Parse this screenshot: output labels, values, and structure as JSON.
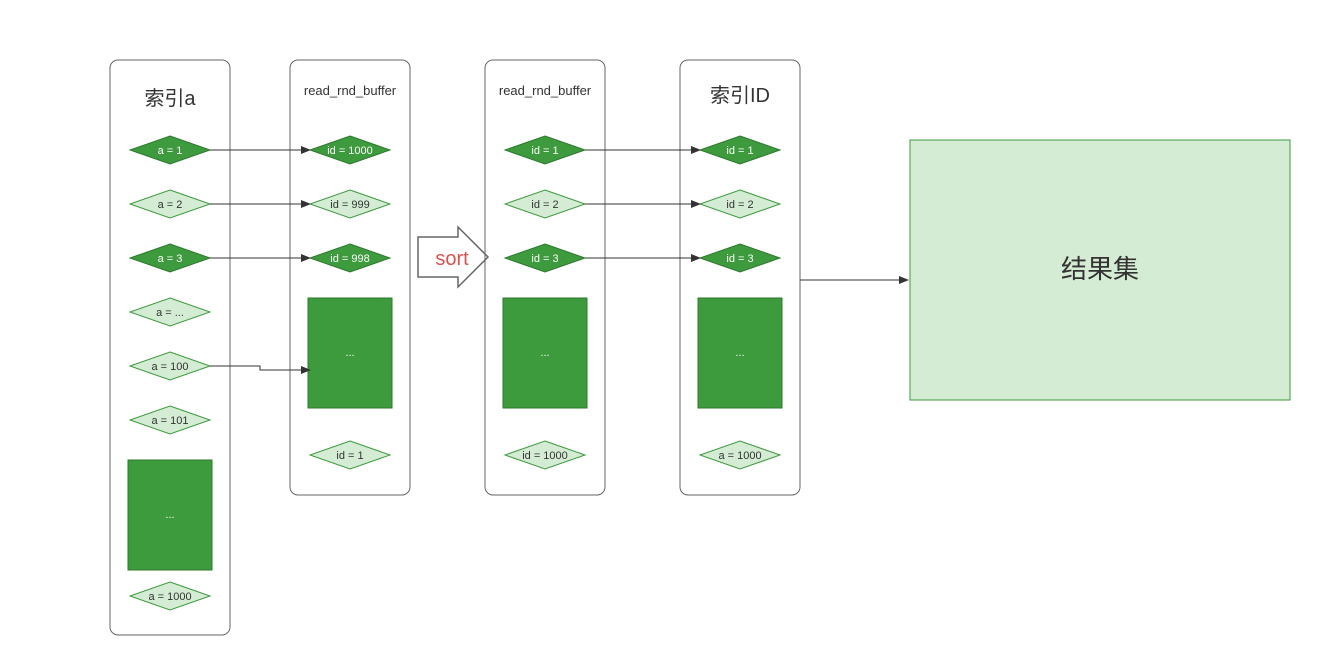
{
  "columns": {
    "col1": {
      "title": "索引a",
      "items": [
        {
          "text": "a = 1",
          "dark": true
        },
        {
          "text": "a = 2",
          "dark": false
        },
        {
          "text": "a = 3",
          "dark": true
        },
        {
          "text": "a = ...",
          "dark": false
        },
        {
          "text": "a = 100",
          "dark": false
        },
        {
          "text": "a = 101",
          "dark": false
        }
      ],
      "last": {
        "text": "a = 1000",
        "dark": false
      }
    },
    "col2": {
      "title": "read_rnd_buffer",
      "items": [
        {
          "text": "id = 1000",
          "dark": true
        },
        {
          "text": "id = 999",
          "dark": false
        },
        {
          "text": "id = 998",
          "dark": true
        }
      ],
      "last": {
        "text": "id = 1",
        "dark": false
      }
    },
    "col3": {
      "title": "read_rnd_buffer",
      "items": [
        {
          "text": "id = 1",
          "dark": true
        },
        {
          "text": "id = 2",
          "dark": false
        },
        {
          "text": "id = 3",
          "dark": true
        }
      ],
      "last": {
        "text": "id = 1000",
        "dark": false
      }
    },
    "col4": {
      "title": "索引ID",
      "items": [
        {
          "text": "id = 1",
          "dark": true
        },
        {
          "text": "id = 2",
          "dark": false
        },
        {
          "text": "id = 3",
          "dark": true
        }
      ],
      "last": {
        "text": "a = 1000",
        "dark": false
      }
    }
  },
  "sort_label": "sort",
  "ellipsis": "...",
  "result_label": "结果集"
}
